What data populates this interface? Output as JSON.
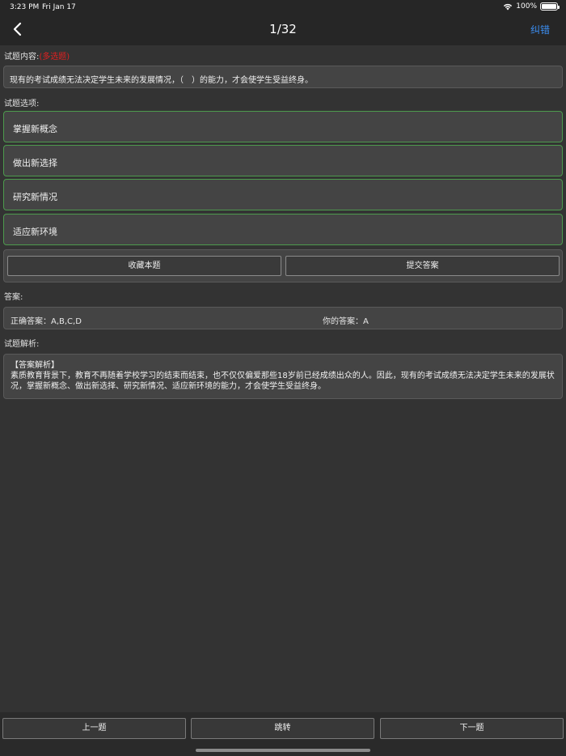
{
  "status": {
    "time": "3:23 PM",
    "date": "Fri Jan 17",
    "battery": "100%"
  },
  "nav": {
    "title": "1/32",
    "report": "纠错"
  },
  "question": {
    "label": "试题内容:",
    "type": "(多选题)",
    "text": "现有的考试成绩无法决定学生未来的发展情况，（　）的能力，才会使学生受益终身。"
  },
  "options_label": "试题选项:",
  "options": [
    "掌握新概念",
    "做出新选择",
    "研究新情况",
    "适应新环境"
  ],
  "actions": {
    "favorite": "收藏本题",
    "submit": "提交答案"
  },
  "answer": {
    "label": "答案:",
    "correct_label": "正确答案：",
    "correct": "A,B,C,D",
    "yours_label": "你的答案：",
    "yours": "A"
  },
  "analysis": {
    "label": "试题解析:",
    "heading": "【答案解析】",
    "text": "素质教育背景下，教育不再随着学校学习的结束而结束，也不仅仅偏爱那些18岁前已经成绩出众的人。因此，现有的考试成绩无法决定学生未来的发展状况，掌握新概念、做出新选择、研究新情况、适应新环境的能力，才会使学生受益终身。"
  },
  "bottom": {
    "prev": "上一题",
    "jump": "跳转",
    "next": "下一题"
  },
  "colors": {
    "accent": "#3b8df0",
    "option_border": "#4d9a4d",
    "type_highlight": "#e02020"
  }
}
